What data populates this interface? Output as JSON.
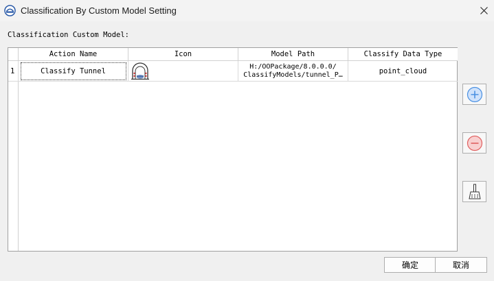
{
  "window": {
    "title": "Classification By Custom Model Setting"
  },
  "section_label": "Classification Custom Model:",
  "table": {
    "columns": [
      "Action Name",
      "Icon",
      "Model Path",
      "Classify Data Type"
    ],
    "rows": [
      {
        "index": "1",
        "action_name": "Classify Tunnel",
        "icon": "tunnel-icon",
        "model_path_line1": "H:/OOPackage/8.0.0.0/",
        "model_path_line2": "ClassifyModels/tunnel_P…",
        "data_type": "point_cloud"
      }
    ]
  },
  "side_buttons": [
    {
      "name": "add",
      "icon": "plus-circle-icon"
    },
    {
      "name": "remove",
      "icon": "minus-circle-icon"
    },
    {
      "name": "clear",
      "icon": "broom-icon"
    }
  ],
  "buttons": {
    "ok": "确定",
    "cancel": "取消"
  },
  "colors": {
    "add": "#4a90e2",
    "remove": "#e06060"
  }
}
